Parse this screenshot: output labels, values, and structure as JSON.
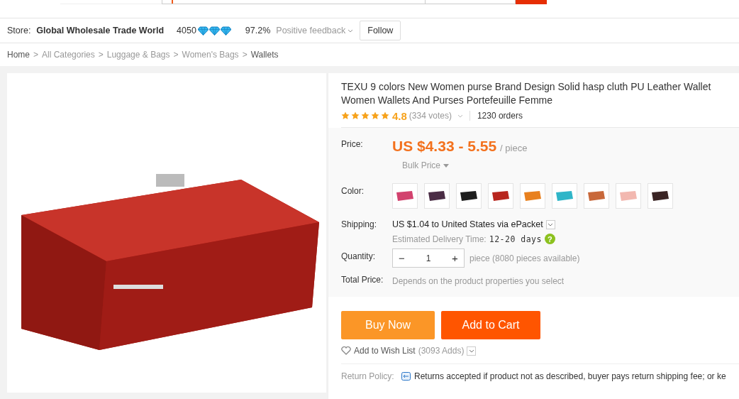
{
  "store": {
    "label": "Store:",
    "name": "Global Wholesale Trade World",
    "score": "4050",
    "level_icons": [
      {
        "kind": "diamond"
      },
      {
        "kind": "diamond"
      },
      {
        "kind": "diamond"
      }
    ],
    "feedback_value": "97.2%",
    "feedback_label": "Positive feedback",
    "follow": "Follow"
  },
  "breadcrumb_separator": ">",
  "breadcrumb": [
    "Home",
    "All Categories",
    "Luggage & Bags",
    "Women's Bags",
    "Wallets"
  ],
  "product": {
    "title": "TEXU 9 colors New Women purse Brand Design Solid hasp cluth PU Leather Wallet Women Wallets And Purses Portefeuille Femme",
    "stars": 5,
    "rating": "4.8",
    "votes": "(334 votes)",
    "orders": "1230 orders",
    "price_label": "Price:",
    "price": "US $4.33 - 5.55",
    "unit": "/ piece",
    "bulk": "Bulk Price",
    "color_label": "Color:",
    "colors": [
      {
        "color": "#d2426e"
      },
      {
        "color": "#4a2d45"
      },
      {
        "color": "#1e1e1e"
      },
      {
        "color": "#b8261e"
      },
      {
        "color": "#e8801e"
      },
      {
        "color": "#2fb5c8"
      },
      {
        "color": "#c8683a"
      },
      {
        "color": "#f2b8b0"
      },
      {
        "color": "#3a2424"
      }
    ],
    "shipping_label": "Shipping:",
    "shipping": "US $1.04 to United States via ePacket",
    "delivery_label": "Estimated Delivery Time:",
    "delivery": "12-20 days",
    "help": "?",
    "quantity_label": "Quantity:",
    "minus": "−",
    "quantity": "1",
    "plus": "+",
    "available": "piece (8080 pieces available)",
    "total_label": "Total Price:",
    "total": "Depends on the product properties you select",
    "buy": "Buy Now",
    "cart": "Add to Cart",
    "wish": "Add to Wish List",
    "wish_count": "(3093 Adds)",
    "return_label": "Return Policy:",
    "return_text": "Returns accepted if product not as described, buyer pays return shipping fee; or ke"
  }
}
